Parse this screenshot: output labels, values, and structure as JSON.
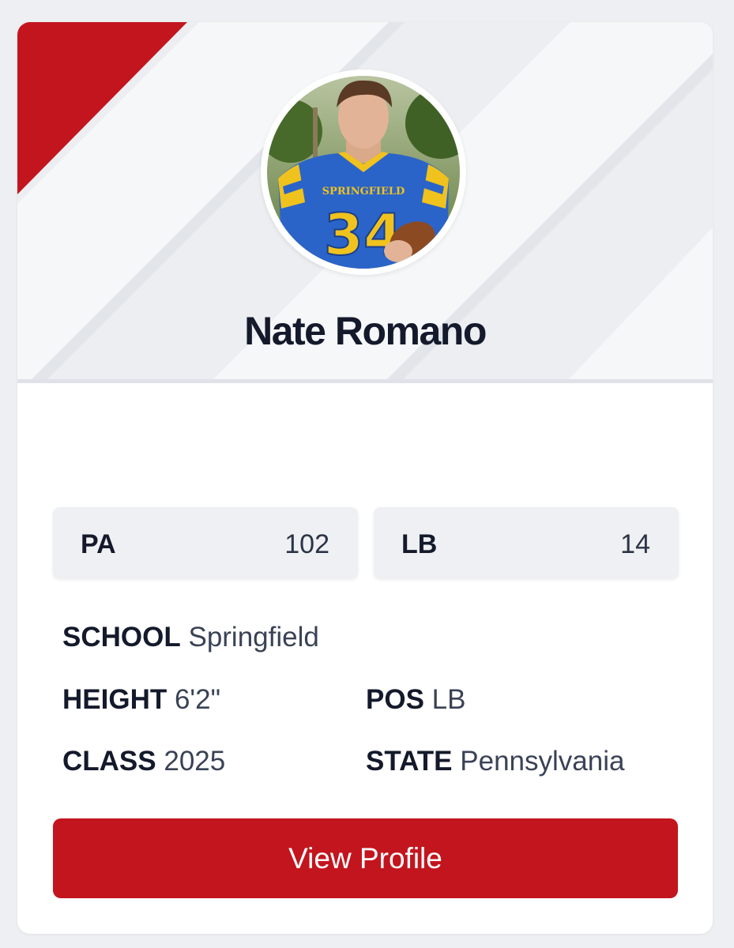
{
  "colors": {
    "accent": "#c3151e",
    "heading": "#141a2b",
    "body_text": "#3a4256",
    "banner_bg": "#eceef1",
    "page_bg": "#eeeff2"
  },
  "player": {
    "name": "Nate Romano",
    "avatar_icon": "player-photo"
  },
  "stats": [
    {
      "label": "PA",
      "value": "102"
    },
    {
      "label": "LB",
      "value": "14"
    }
  ],
  "details": {
    "school": {
      "label": "SCHOOL",
      "value": "Springfield"
    },
    "height": {
      "label": "HEIGHT",
      "value": "6'2\""
    },
    "pos": {
      "label": "POS",
      "value": "LB"
    },
    "class": {
      "label": "CLASS",
      "value": "2025"
    },
    "state": {
      "label": "STATE",
      "value": "Pennsylvania"
    }
  },
  "actions": {
    "view_profile_label": "View Profile"
  }
}
